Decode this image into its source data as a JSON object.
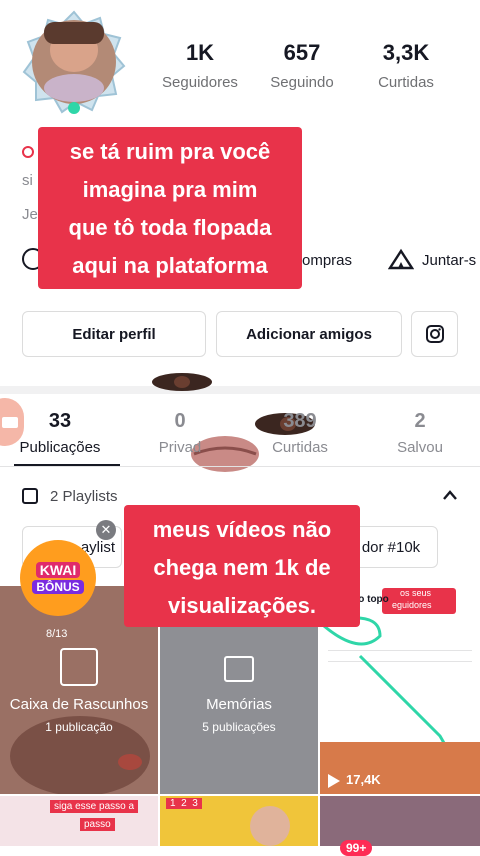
{
  "profile": {
    "stats": [
      {
        "value": "1K",
        "label": "Seguidores"
      },
      {
        "value": "657",
        "label": "Seguindo"
      },
      {
        "value": "3,3K",
        "label": "Curtidas"
      }
    ],
    "bio_fragment_1": "si",
    "bio_fragment_2": "Je",
    "shortcuts": [
      "ompras",
      "Juntar-s"
    ]
  },
  "overlay_top": [
    "se tá ruim pra você",
    "imagina pra mim",
    "que tô toda flopada",
    "aqui na plataforma"
  ],
  "overlay_mid": [
    "meus vídeos não",
    "chega nem 1k de",
    "visualizações."
  ],
  "buttons": {
    "edit_profile": "Editar perfil",
    "add_friends": "Adicionar amigos"
  },
  "tabs": [
    {
      "value": "33",
      "label": "Publicações"
    },
    {
      "value": "0",
      "label": "Privad"
    },
    {
      "value": "389",
      "label": "Curtidas"
    },
    {
      "value": "2",
      "label": "Salvou"
    }
  ],
  "playlists": {
    "label": "2 Playlists",
    "chip1": "aylist",
    "chip2": "dor #10k"
  },
  "kwai_badge": {
    "line1": "KWAI",
    "line2": "BÔNUS"
  },
  "grid": {
    "drafts_title": "Caixa de Rascunhos",
    "drafts_count": "1 publicação",
    "drafts_progress": "8/13",
    "memories_title": "Memórias",
    "memories_count": "5 publicações",
    "thumb_text_1": "xado no topo",
    "thumb_text_2": "os seus",
    "thumb_text_3": "eguidores",
    "thumb_views": "17,4K",
    "bottom_text_1": "siga esse passo a",
    "bottom_text_2": "passo",
    "bottom_nums": "1  2  3"
  },
  "nav": {
    "badge": "99+"
  },
  "colors": {
    "accent": "#e8334a",
    "teal": "#2fd6a8"
  }
}
